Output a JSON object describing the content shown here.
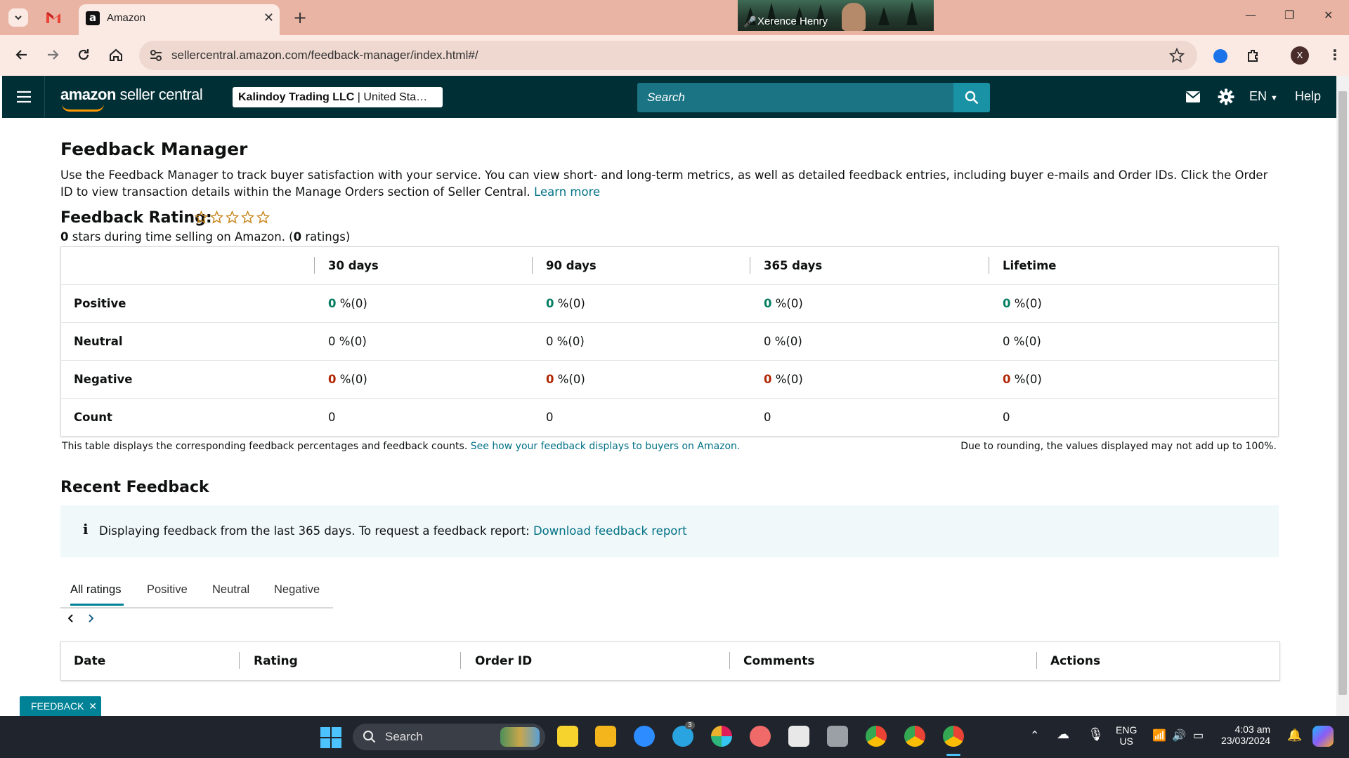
{
  "browser": {
    "tab_title": "Amazon",
    "url": "sellercentral.amazon.com/feedback-manager/index.html#/",
    "video_call_name": "Xerence Henry",
    "profile_initial": "X"
  },
  "header": {
    "logo_main": "amazon",
    "logo_sub": "seller central",
    "account_name": "Kalindoy Trading LLC",
    "account_region": "| United Sta…",
    "search_placeholder": "Search",
    "language": "EN",
    "help": "Help"
  },
  "page": {
    "title": "Feedback Manager",
    "description": "Use the Feedback Manager to track buyer satisfaction with your service. You can view short- and long-term metrics, as well as detailed feedback entries, including buyer e-mails and Order IDs. Click the Order ID to view transaction details within the Manage Orders section of Seller Central.",
    "learn_more": "Learn more",
    "rating_label": "Feedback Rating:",
    "stars_filled": 0,
    "stars_total": 5,
    "rating_stars_value": "0",
    "rating_sub_mid": " stars during time selling on Amazon. (",
    "rating_count_value": "0",
    "rating_sub_end": " ratings)"
  },
  "feedback_table": {
    "columns": [
      "30 days",
      "90 days",
      "365 days",
      "Lifetime"
    ],
    "rows": [
      {
        "label": "Positive",
        "cells": [
          {
            "v": "0",
            "s": " %(0)"
          },
          {
            "v": "0",
            "s": " %(0)"
          },
          {
            "v": "0",
            "s": " %(0)"
          },
          {
            "v": "0",
            "s": " %(0)"
          }
        ]
      },
      {
        "label": "Neutral",
        "cells": [
          {
            "v": "0",
            "s": " %(0)"
          },
          {
            "v": "0",
            "s": " %(0)"
          },
          {
            "v": "0",
            "s": " %(0)"
          },
          {
            "v": "0",
            "s": " %(0)"
          }
        ]
      },
      {
        "label": "Negative",
        "cells": [
          {
            "v": "0",
            "s": " %(0)"
          },
          {
            "v": "0",
            "s": " %(0)"
          },
          {
            "v": "0",
            "s": " %(0)"
          },
          {
            "v": "0",
            "s": " %(0)"
          }
        ]
      },
      {
        "label": "Count",
        "cells": [
          {
            "v": "0",
            "s": ""
          },
          {
            "v": "0",
            "s": ""
          },
          {
            "v": "0",
            "s": ""
          },
          {
            "v": "0",
            "s": ""
          }
        ]
      }
    ],
    "note_left": "This table displays the corresponding feedback percentages and feedback counts.",
    "note_link": "See how your feedback displays to buyers on Amazon.",
    "note_right": "Due to rounding, the values displayed may not add up to 100%."
  },
  "recent": {
    "title": "Recent Feedback",
    "info_text": "Displaying feedback from the last 365 days. To request a feedback report:",
    "info_link": "Download feedback report",
    "tabs": [
      "All ratings",
      "Positive",
      "Neutral",
      "Negative"
    ],
    "columns": [
      "Date",
      "Rating",
      "Order ID",
      "Comments",
      "Actions"
    ]
  },
  "feedback_button": "FEEDBACK",
  "taskbar": {
    "search": "Search",
    "lang_top": "ENG",
    "lang_bottom": "US",
    "time": "4:03 am",
    "date": "23/03/2024",
    "telegram_badge": "3"
  },
  "colors": {
    "header_bg": "#002f36",
    "link": "#007185",
    "positive": "#067d62",
    "negative": "#b12704",
    "tab_underline": "#008296",
    "browser_frame": "#e9b4a3"
  }
}
